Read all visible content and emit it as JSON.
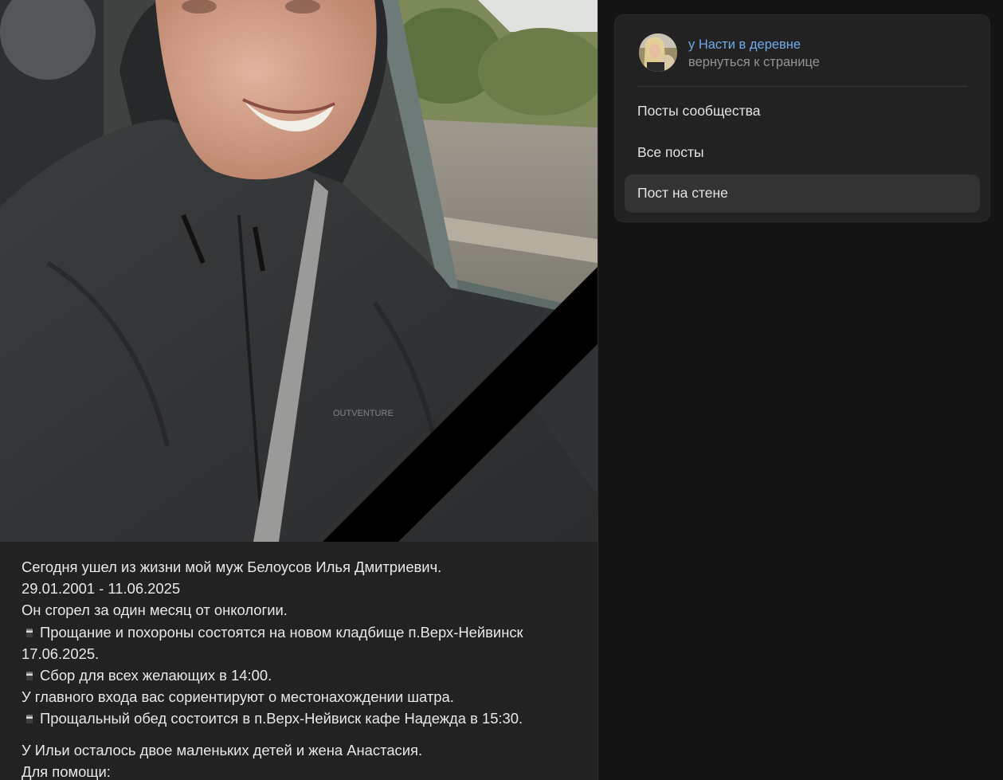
{
  "post": {
    "photo_alt": "",
    "lines": [
      "Сегодня ушел из жизни мой муж Белоусов Илья Дмитриевич.",
      "29.01.2001 - 11.06.2025",
      "Он сгорел за один месяц от онкологии.",
      "Прощание и похороны состоятся на новом кладбище п.Верх-Нейвинск",
      "17.06.2025.",
      "Сбор для всех желающих в 14:00.",
      "У главного входа вас сориентируют о местонахождении шатра.",
      "Прощальный обед состоится в п.Верх-Нейвиск кафе Надежда в 15:30.",
      "У Ильи осталось двое маленьких детей и жена Анастасия.",
      "Для помощи:"
    ],
    "bullet_icon": "memo-pad-icon",
    "photo_label_text": "OUTVENTURE"
  },
  "sidebar": {
    "community": {
      "name": "у Насти в деревне",
      "back_link": "вернуться к странице"
    },
    "menu": [
      {
        "label": "Посты сообщества",
        "active": false
      },
      {
        "label": "Все посты",
        "active": false
      },
      {
        "label": "Пост на стене",
        "active": true
      }
    ]
  },
  "colors": {
    "background": "#141414",
    "card": "#222222",
    "link": "#71aaeb",
    "muted": "#939393",
    "active_item": "#333333",
    "mourning_ribbon": "#000000"
  }
}
